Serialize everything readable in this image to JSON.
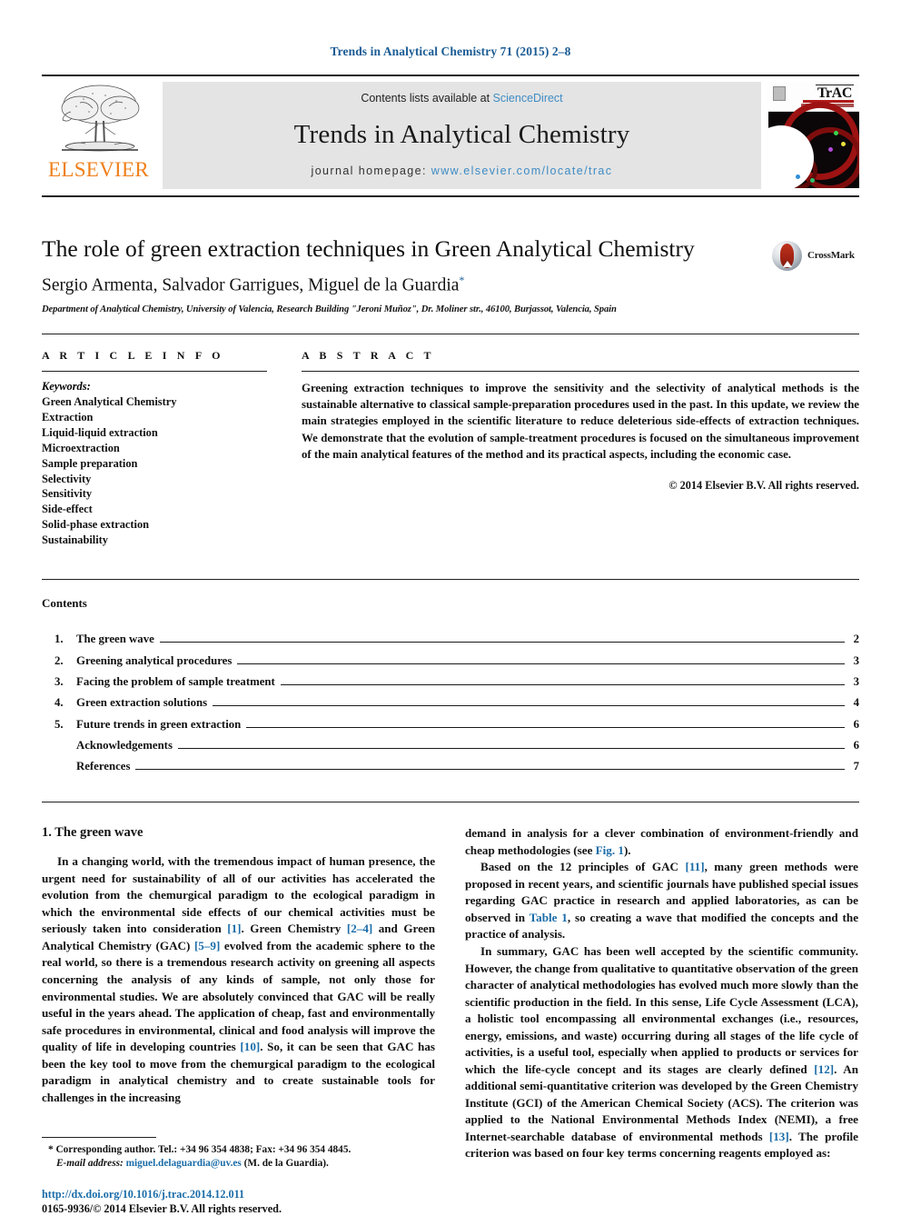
{
  "running_head": "Trends in Analytical Chemistry 71 (2015) 2–8",
  "masthead": {
    "contents_prefix": "Contents lists available at ",
    "sciencedirect": "ScienceDirect",
    "journal_name": "Trends in Analytical Chemistry",
    "homepage_prefix": "journal homepage: ",
    "homepage_url": "www.elsevier.com/locate/trac",
    "publisher_logo_text": "ELSEVIER",
    "cover_mark": "TrAC",
    "link_color": "#3f8cc4"
  },
  "title_block": {
    "title": "The role of green extraction techniques in Green Analytical Chemistry",
    "authors": "Sergio Armenta, Salvador Garrigues, Miguel de la Guardia",
    "corresponding_marker": "*",
    "affiliation": "Department of Analytical Chemistry, University of Valencia, Research Building \"Jeroni Muñoz\", Dr. Moliner str., 46100, Burjassot, Valencia, Spain",
    "crossmark_label": "CrossMark"
  },
  "article_info": {
    "heading": "A R T I C L E   I N F O",
    "keywords_label": "Keywords:",
    "keywords": [
      "Green Analytical Chemistry",
      "Extraction",
      "Liquid-liquid extraction",
      "Microextraction",
      "Sample preparation",
      "Selectivity",
      "Sensitivity",
      "Side-effect",
      "Solid-phase extraction",
      "Sustainability"
    ]
  },
  "abstract": {
    "heading": "A B S T R A C T",
    "text": "Greening extraction techniques to improve the sensitivity and the selectivity of analytical methods is the sustainable alternative to classical sample-preparation procedures used in the past. In this update, we review the main strategies employed in the scientific literature to reduce deleterious side-effects of extraction techniques. We demonstrate that the evolution of sample-treatment procedures is focused on the simultaneous improvement of the main analytical features of the method and its practical aspects, including the economic case.",
    "copyright": "© 2014 Elsevier B.V. All rights reserved."
  },
  "contents": {
    "heading": "Contents",
    "items": [
      {
        "num": "1.",
        "label": "The green wave",
        "page": "2"
      },
      {
        "num": "2.",
        "label": "Greening analytical procedures",
        "page": "3"
      },
      {
        "num": "3.",
        "label": "Facing the problem of sample treatment",
        "page": "3"
      },
      {
        "num": "4.",
        "label": "Green extraction solutions",
        "page": "4"
      },
      {
        "num": "5.",
        "label": "Future trends in green extraction",
        "page": "6"
      },
      {
        "num": "",
        "label": "Acknowledgements",
        "page": "6"
      },
      {
        "num": "",
        "label": "References",
        "page": "7"
      }
    ]
  },
  "body": {
    "section_heading": "1. The green wave",
    "left_paragraph_1_a": "In a changing world, with the tremendous impact of human presence, the urgent need for sustainability of all of our activities has accelerated the evolution from the chemurgical paradigm to the ecological paradigm in which the environmental side effects of our chemical activities must be seriously taken into consideration ",
    "ref_1": "[1]",
    "left_paragraph_1_b": ". Green Chemistry ",
    "ref_2_4": "[2–4]",
    "left_paragraph_1_c": " and Green Analytical Chemistry (GAC) ",
    "ref_5_9": "[5–9]",
    "left_paragraph_1_d": " evolved from the academic sphere to the real world, so there is a tremendous research activity on greening all aspects concerning the analysis of any kinds of sample, not only those for environmental studies. We are absolutely convinced that GAC will be really useful in the years ahead. The application of cheap, fast and environmentally safe procedures in environmental, clinical and food analysis will improve the quality of life in developing countries ",
    "ref_10": "[10]",
    "left_paragraph_1_e": ". So, it can be seen that GAC has been the key tool to move from the chemurgical paradigm to the ecological paradigm in analytical chemistry and to create sustainable tools for challenges in the increasing",
    "right_continuation_a": "demand in analysis for a clever combination of environment-friendly and cheap methodologies (see ",
    "ref_fig1": "Fig. 1",
    "right_continuation_b": ").",
    "right_paragraph_2_a": "Based on the 12 principles of GAC ",
    "ref_11": "[11]",
    "right_paragraph_2_b": ", many green methods were proposed in recent years, and scientific journals have published special issues regarding GAC practice in research and applied laboratories, as can be observed in ",
    "ref_table1": "Table 1",
    "right_paragraph_2_c": ", so creating a wave that modified the concepts and the practice of analysis.",
    "right_paragraph_3_a": "In summary, GAC has been well accepted by the scientific community. However, the change from qualitative to quantitative observation of the green character of analytical methodologies has evolved much more slowly than the scientific production in the field. In this sense, Life Cycle Assessment (LCA), a holistic tool encompassing all environmental exchanges (i.e., resources, energy, emissions, and waste) occurring during all stages of the life cycle of activities, is a useful tool, especially when applied to products or services for which the life-cycle concept and its stages are clearly defined ",
    "ref_12": "[12]",
    "right_paragraph_3_b": ". An additional semi-quantitative criterion was developed by the Green Chemistry Institute (GCI) of the American Chemical Society (ACS). The criterion was applied to the National Environmental Methods Index (NEMI), a free Internet-searchable database of environmental methods ",
    "ref_13": "[13]",
    "right_paragraph_3_c": ". The profile criterion was based on four key terms concerning reagents employed as:"
  },
  "footnote": {
    "star": "*",
    "corresponding": "Corresponding author. Tel.: +34 96 354 4838; Fax: +34 96 354 4845.",
    "email_label": "E-mail address:",
    "email": "miguel.delaguardia@uv.es",
    "email_suffix": "(M. de la Guardia).",
    "doi": "http://dx.doi.org/10.1016/j.trac.2014.12.011",
    "issn": "0165-9936/© 2014 Elsevier B.V. All rights reserved."
  }
}
